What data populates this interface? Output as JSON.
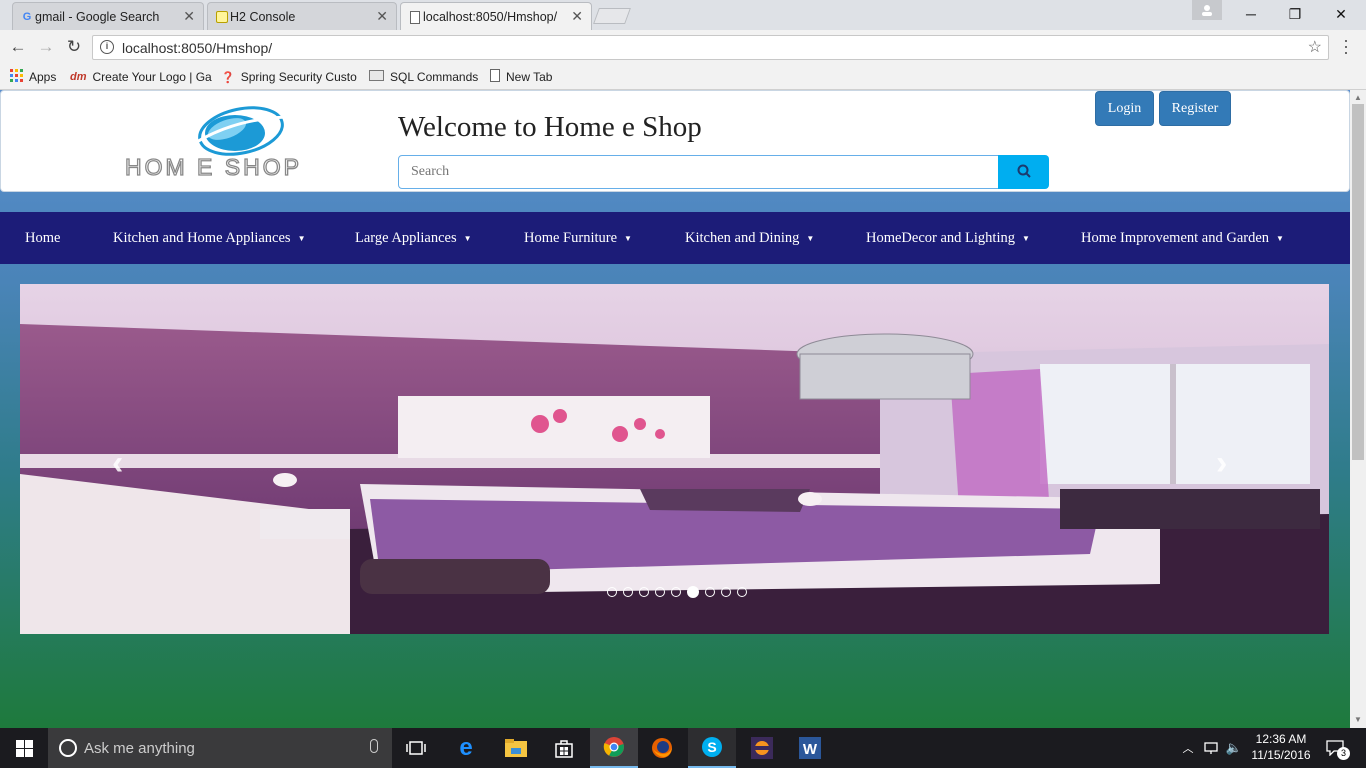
{
  "browser": {
    "tabs": [
      {
        "title": "gmail - Google Search",
        "favicon": "google-icon"
      },
      {
        "title": "H2 Console",
        "favicon": "h2-icon"
      },
      {
        "title": "localhost:8050/Hmshop/",
        "favicon": "page-icon",
        "active": true
      }
    ],
    "url": "localhost:8050/Hmshop/",
    "bookmarks": [
      "Apps",
      "Create Your Logo | Ga",
      "Spring Security Custo",
      "SQL Commands",
      "New Tab"
    ]
  },
  "site": {
    "logo_text": "HOM E SHOP",
    "welcome": "Welcome to Home e Shop",
    "search_placeholder": "Search",
    "login_label": "Login",
    "register_label": "Register",
    "nav": [
      {
        "label": "Home",
        "dropdown": false
      },
      {
        "label": "Kitchen and Home Appliances",
        "dropdown": true
      },
      {
        "label": "Large Appliances",
        "dropdown": true
      },
      {
        "label": "Home Furniture",
        "dropdown": true
      },
      {
        "label": "Kitchen and Dining",
        "dropdown": true
      },
      {
        "label": "HomeDecor and Lighting",
        "dropdown": true
      },
      {
        "label": "Home Improvement and Garden",
        "dropdown": true
      }
    ],
    "carousel": {
      "slide_count": 9,
      "active_index": 5
    }
  },
  "taskbar": {
    "search_placeholder": "Ask me anything",
    "time": "12:36 AM",
    "date": "11/15/2016",
    "notification_count": "3"
  },
  "colors": {
    "navbar": "#1c1c78",
    "primary_button": "#337ab7",
    "search_button": "#00aef0"
  }
}
